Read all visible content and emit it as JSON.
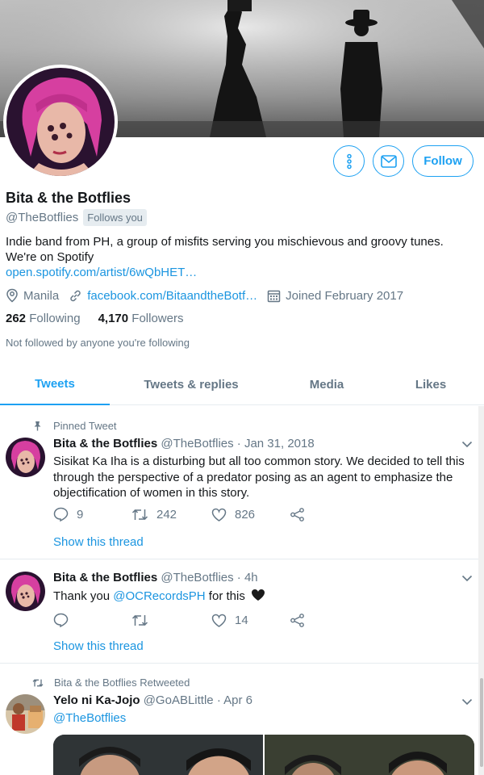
{
  "profile": {
    "name": "Bita & the Botflies",
    "handle": "@TheBotflies",
    "follows_you": "Follows you",
    "bio": "Indie band from PH, a group of misfits serving you mischievous and groovy tunes. We're on Spotify",
    "bio_link": "open.spotify.com/artist/6wQbHET…",
    "location": "Manila",
    "website": "facebook.com/BitaandtheBotf…",
    "joined": "Joined February 2017",
    "following_count": "262",
    "following_label": "Following",
    "followers_count": "4,170",
    "followers_label": "Followers",
    "not_followed": "Not followed by anyone you're following"
  },
  "buttons": {
    "more_icon": "more-vertical-icon",
    "message_icon": "envelope-icon",
    "follow_label": "Follow"
  },
  "tabs": [
    {
      "label": "Tweets",
      "active": true
    },
    {
      "label": "Tweets & replies",
      "active": false
    },
    {
      "label": "Media",
      "active": false
    },
    {
      "label": "Likes",
      "active": false
    }
  ],
  "tweets": [
    {
      "context": "Pinned Tweet",
      "name": "Bita & the Botflies",
      "handle": "@TheBotflies",
      "time": "· Jan 31, 2018",
      "text": "Sisikat Ka Iha is a disturbing but all too common story. We decided to tell this through the perspective of a predator posing as an agent to emphasize the objectification of women in this story.",
      "replies": "9",
      "retweets": "242",
      "likes": "826",
      "thread_link": "Show this thread"
    },
    {
      "name": "Bita & the Botflies",
      "handle": "@TheBotflies",
      "time": "· 4h",
      "text_pre": "Thank you ",
      "mention": "@OCRecordsPH",
      "text_post": " for this",
      "emoji": "🖤",
      "replies": "",
      "retweets": "",
      "likes": "14",
      "thread_link": "Show this thread"
    },
    {
      "context": "Bita & the Botflies Retweeted",
      "name": "Yelo ni Ka-Jojo",
      "handle": "@GoABLittle",
      "time": "· Apr 6",
      "mention": "@TheBotflies"
    }
  ],
  "colors": {
    "accent": "#1da1f2",
    "link": "#1b95e0",
    "secondary_text": "#657786",
    "divider": "#e6ecf0"
  }
}
